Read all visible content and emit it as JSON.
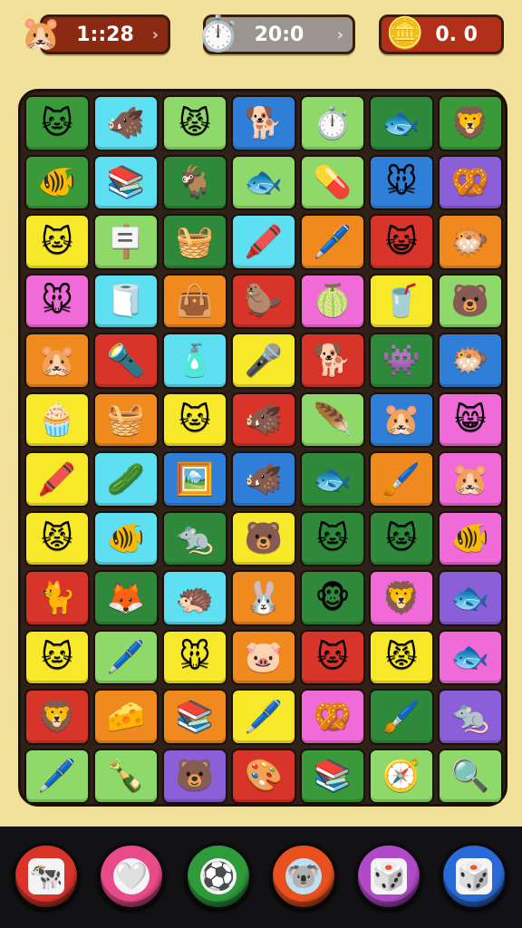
{
  "hud": {
    "left": {
      "value": "1::28",
      "icon": "hamster-avatar-icon"
    },
    "middle": {
      "value": "20:0",
      "icon": "stopwatch-icon"
    },
    "right": {
      "value": "0. 0",
      "icon": "gold-coin-icon"
    }
  },
  "colors": {
    "green": "#3a9a3a",
    "cyan": "#5ee0f2",
    "lime": "#8fd96a",
    "blue": "#2f7fd8",
    "orange": "#f08a1f",
    "purple": "#8a5fd8",
    "yellow": "#f8e82a",
    "pink": "#f06ad8",
    "red": "#d8342a",
    "dgreen": "#2e8a3a",
    "teal": "#2a9a8a"
  },
  "board": {
    "rows": [
      [
        {
          "c": "green",
          "i": "🐱"
        },
        {
          "c": "cyan",
          "i": "🐗"
        },
        {
          "c": "lime",
          "i": "😾"
        },
        {
          "c": "blue",
          "i": "🐕"
        },
        {
          "c": "lime",
          "i": "⏱️"
        },
        {
          "c": "dgreen",
          "i": "🐟"
        },
        {
          "c": "green",
          "i": "🦁"
        }
      ],
      [
        {
          "c": "green",
          "i": "🐠"
        },
        {
          "c": "cyan",
          "i": "📚"
        },
        {
          "c": "dgreen",
          "i": "🐐"
        },
        {
          "c": "lime",
          "i": "🐟"
        },
        {
          "c": "lime",
          "i": "💊"
        },
        {
          "c": "blue",
          "i": "🐭"
        },
        {
          "c": "purple",
          "i": "🥨"
        }
      ],
      [
        {
          "c": "yellow",
          "i": "🐱"
        },
        {
          "c": "lime",
          "i": "🪧"
        },
        {
          "c": "dgreen",
          "i": "🧺"
        },
        {
          "c": "cyan",
          "i": "🖍️"
        },
        {
          "c": "orange",
          "i": "🖊️"
        },
        {
          "c": "red",
          "i": "😺"
        },
        {
          "c": "orange",
          "i": "🐡"
        }
      ],
      [
        {
          "c": "pink",
          "i": "🐭"
        },
        {
          "c": "cyan",
          "i": "🧻"
        },
        {
          "c": "orange",
          "i": "👜"
        },
        {
          "c": "red",
          "i": "🦫"
        },
        {
          "c": "pink",
          "i": "🍈"
        },
        {
          "c": "yellow",
          "i": "🥤"
        },
        {
          "c": "lime",
          "i": "🐻"
        }
      ],
      [
        {
          "c": "orange",
          "i": "🐹"
        },
        {
          "c": "red",
          "i": "🔦"
        },
        {
          "c": "cyan",
          "i": "🧴"
        },
        {
          "c": "yellow",
          "i": "🎤"
        },
        {
          "c": "red",
          "i": "🐕"
        },
        {
          "c": "dgreen",
          "i": "👾"
        },
        {
          "c": "blue",
          "i": "🐡"
        }
      ],
      [
        {
          "c": "yellow",
          "i": "🧁"
        },
        {
          "c": "orange",
          "i": "🧺"
        },
        {
          "c": "yellow",
          "i": "🐱"
        },
        {
          "c": "red",
          "i": "🐗"
        },
        {
          "c": "lime",
          "i": "🪶"
        },
        {
          "c": "blue",
          "i": "🐹"
        },
        {
          "c": "pink",
          "i": "😸"
        }
      ],
      [
        {
          "c": "yellow",
          "i": "🖍️"
        },
        {
          "c": "cyan",
          "i": "🥒"
        },
        {
          "c": "blue",
          "i": "🖼️"
        },
        {
          "c": "blue",
          "i": "🐗"
        },
        {
          "c": "dgreen",
          "i": "🐟"
        },
        {
          "c": "orange",
          "i": "🖌️"
        },
        {
          "c": "pink",
          "i": "🐹"
        }
      ],
      [
        {
          "c": "yellow",
          "i": "😾"
        },
        {
          "c": "cyan",
          "i": "🐠"
        },
        {
          "c": "dgreen",
          "i": "🐀"
        },
        {
          "c": "yellow",
          "i": "🐻"
        },
        {
          "c": "dgreen",
          "i": "🐱"
        },
        {
          "c": "dgreen",
          "i": "🐱"
        },
        {
          "c": "pink",
          "i": "🐠"
        }
      ],
      [
        {
          "c": "red",
          "i": "🐈"
        },
        {
          "c": "dgreen",
          "i": "🦊"
        },
        {
          "c": "cyan",
          "i": "🦔"
        },
        {
          "c": "orange",
          "i": "🐰"
        },
        {
          "c": "dgreen",
          "i": "🐵"
        },
        {
          "c": "pink",
          "i": "🦁"
        },
        {
          "c": "purple",
          "i": "🐟"
        }
      ],
      [
        {
          "c": "yellow",
          "i": "🐱"
        },
        {
          "c": "lime",
          "i": "🖊️"
        },
        {
          "c": "yellow",
          "i": "🐭"
        },
        {
          "c": "orange",
          "i": "🐷"
        },
        {
          "c": "red",
          "i": "🐱"
        },
        {
          "c": "yellow",
          "i": "😾"
        },
        {
          "c": "pink",
          "i": "🐟"
        }
      ],
      [
        {
          "c": "red",
          "i": "🦁"
        },
        {
          "c": "orange",
          "i": "🧀"
        },
        {
          "c": "orange",
          "i": "📚"
        },
        {
          "c": "yellow",
          "i": "🖊️"
        },
        {
          "c": "pink",
          "i": "🥨"
        },
        {
          "c": "dgreen",
          "i": "🖌️"
        },
        {
          "c": "purple",
          "i": "🐀"
        }
      ],
      [
        {
          "c": "lime",
          "i": "🖊️"
        },
        {
          "c": "lime",
          "i": "🍾"
        },
        {
          "c": "purple",
          "i": "🐻"
        },
        {
          "c": "red",
          "i": "🎨"
        },
        {
          "c": "green",
          "i": "📚"
        },
        {
          "c": "lime",
          "i": "🧭"
        },
        {
          "c": "lime",
          "i": "🔍"
        }
      ]
    ]
  },
  "toolbar": [
    {
      "name": "shuffle-button",
      "color": "#d8342a",
      "inner": "#f4f4f4",
      "icon": "🐄"
    },
    {
      "name": "hint-button",
      "color": "#e84a8a",
      "inner": "#f4f4f4",
      "icon": "🤍"
    },
    {
      "name": "ball-button",
      "color": "#2e9a3a",
      "inner": "#f4f4f4",
      "icon": "⚽"
    },
    {
      "name": "animal-button",
      "color": "#e8501f",
      "inner": "#bde0f0",
      "icon": "🐨"
    },
    {
      "name": "dice-button",
      "color": "#b04ac8",
      "inner": "#f4f4f4",
      "icon": "🎲"
    },
    {
      "name": "dice-button-2",
      "color": "#2a6ad8",
      "inner": "#f4f4f4",
      "icon": "🎲"
    }
  ]
}
